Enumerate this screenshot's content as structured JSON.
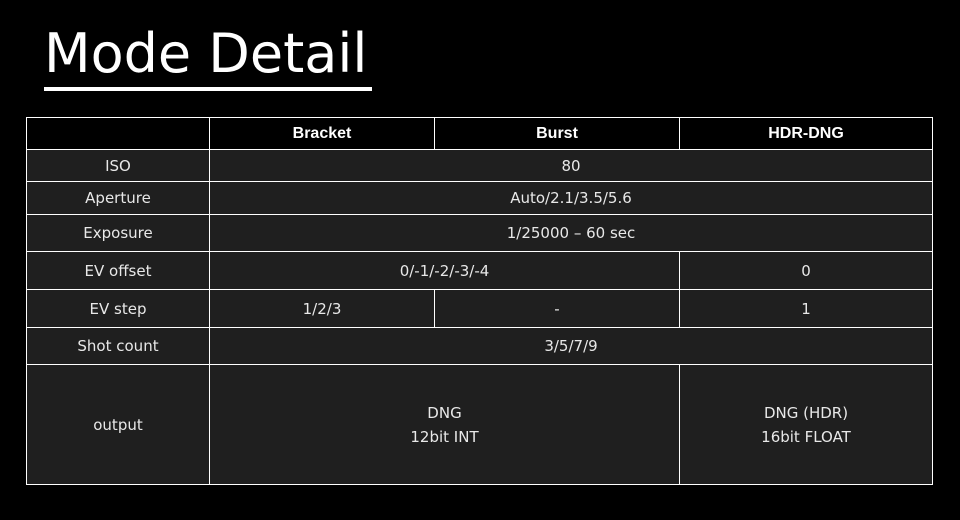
{
  "title": "Mode Detail",
  "table": {
    "columns": [
      "",
      "Bracket",
      "Burst",
      "HDR-DNG"
    ],
    "rows": {
      "iso": {
        "label": "ISO",
        "all": "80"
      },
      "aperture": {
        "label": "Aperture",
        "all": "Auto/2.1/3.5/5.6"
      },
      "exposure": {
        "label": "Exposure",
        "all": "1/25000 – 60 sec"
      },
      "ev_offset": {
        "label": "EV offset",
        "bracket_burst": "0/-1/-2/-3/-4",
        "hdr_dng": "0"
      },
      "ev_step": {
        "label": "EV step",
        "bracket": "1/2/3",
        "burst": "-",
        "hdr_dng": "1"
      },
      "shot_count": {
        "label": "Shot count",
        "all": "3/5/7/9"
      },
      "output": {
        "label": "output",
        "bracket_burst_line1": "DNG",
        "bracket_burst_line2": "12bit INT",
        "hdr_dng_line1": "DNG (HDR)",
        "hdr_dng_line2": "16bit FLOAT"
      }
    }
  }
}
